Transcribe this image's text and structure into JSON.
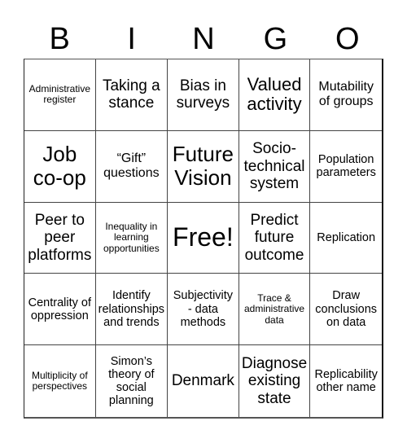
{
  "header": {
    "letters": [
      "B",
      "I",
      "N",
      "G",
      "O"
    ]
  },
  "board": {
    "rows": [
      [
        "Administrative register",
        "Taking a stance",
        "Bias in surveys",
        "Valued activity",
        "Mutability of groups"
      ],
      [
        "Job co-op",
        "“Gift” questions",
        "Future Vision",
        "Socio-technical system",
        "Population parameters"
      ],
      [
        "Peer to peer platforms",
        "Inequality in learning opportunities",
        "Free!",
        "Predict future outcome",
        "Replication"
      ],
      [
        "Centrality of oppression",
        "Identify relationships and trends",
        "Subjectivity - data methods",
        "Trace & administrative data",
        "Draw conclusions on data"
      ],
      [
        "Multiplicity of perspectives",
        "Simon’s theory of social planning",
        "Denmark",
        "Diagnose existing state",
        "Replicability other name"
      ]
    ]
  }
}
